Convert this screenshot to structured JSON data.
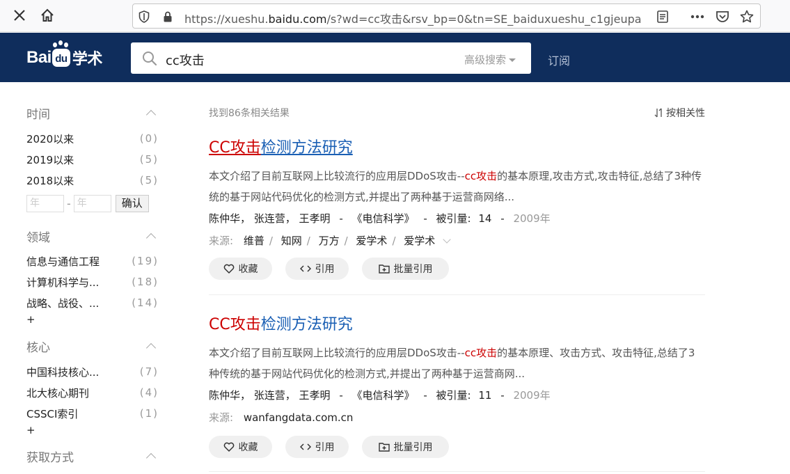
{
  "browser": {
    "url_prefix": "https://xueshu.",
    "url_domain": "baidu.com",
    "url_rest": "/s?wd=cc攻击&rsv_bp=0&tn=SE_baiduxueshu_c1gjeupa"
  },
  "header": {
    "logo_text_1": "Bai",
    "logo_text_2": "du",
    "logo_text_3": "学术",
    "search_query": "cc攻击",
    "advanced_search": "高级搜索",
    "subscribe": "订阅"
  },
  "sidebar": {
    "time": {
      "title": "时间",
      "items": [
        {
          "label": "2020以来",
          "count": "(0)"
        },
        {
          "label": "2019以来",
          "count": "(5)"
        },
        {
          "label": "2018以来",
          "count": "(5)"
        }
      ],
      "year_placeholder": "年",
      "confirm": "确认"
    },
    "field": {
      "title": "领域",
      "items": [
        {
          "label": "信息与通信工程",
          "count": "(19)"
        },
        {
          "label": "计算机科学与...",
          "count": "(18)"
        },
        {
          "label": "战略、战役、...",
          "count": "(14)"
        }
      ],
      "more": "+"
    },
    "core": {
      "title": "核心",
      "items": [
        {
          "label": "中国科技核心...",
          "count": "(7)"
        },
        {
          "label": "北大核心期刊",
          "count": "(4)"
        },
        {
          "label": "CSSCI索引",
          "count": "(1)"
        }
      ],
      "more": "+"
    },
    "access": {
      "title": "获取方式"
    }
  },
  "main": {
    "found": "找到86条相关结果",
    "sort": "按相关性",
    "results": [
      {
        "title_hl": "CC攻击",
        "title_rest": "检测方法研究",
        "abstract_pre": "本文介绍了目前互联网上比较流行的应用层DDoS攻击--",
        "abstract_hl": "cc攻击",
        "abstract_post": "的基本原理,攻击方式,攻击特征,总结了3种传统的基于网站代码优化的检测方式,并提出了两种基于运营商网络...",
        "authors": "陈仲华， 张连营， 王孝明",
        "journal": "《电信科学》",
        "cited_label": "被引量:",
        "cited": "14",
        "year": "2009年",
        "source_label": "来源:",
        "sources": [
          "维普",
          "知网",
          "万方",
          "爱学术",
          "爱学术"
        ]
      },
      {
        "title_hl": "CC攻击",
        "title_rest": "检测方法研究",
        "abstract_pre": "本文介绍了目前互联网上比较流行的应用层DDoS攻击--",
        "abstract_hl": "cc攻击",
        "abstract_post": "的基本原理、攻击方式、攻击特征,总结了3种传统的基于网站代码优化的检测方式,并提出了两种基于运营商网...",
        "authors": "陈仲华， 张连营， 王孝明",
        "journal": "《电信科学》",
        "cited_label": "被引量:",
        "cited": "11",
        "year": "2009年",
        "source_label": "来源:",
        "source_single": "wanfangdata.com.cn"
      }
    ],
    "actions": {
      "collect": "收藏",
      "cite": "引用",
      "batch_cite": "批量引用"
    }
  }
}
